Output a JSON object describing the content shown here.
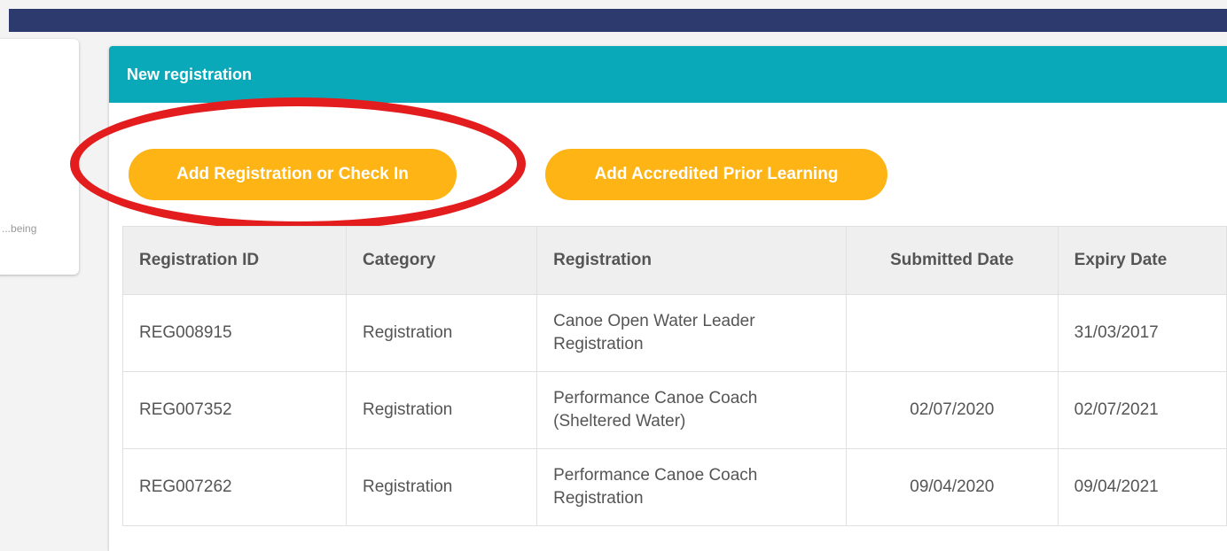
{
  "side": {
    "snippet": "being..."
  },
  "panel": {
    "title": "New registration",
    "buttons": {
      "add_registration": "Add Registration or Check In",
      "add_apl": "Add Accredited Prior Learning"
    }
  },
  "table": {
    "headers": [
      "Registration ID",
      "Category",
      "Registration",
      "Submitted Date",
      "Expiry Date"
    ],
    "rows": [
      {
        "id": "REG008915",
        "category": "Registration",
        "registration": "Canoe Open Water Leader Registration",
        "submitted": "",
        "expiry": "31/03/2017"
      },
      {
        "id": "REG007352",
        "category": "Registration",
        "registration": "Performance Canoe Coach (Sheltered Water)",
        "submitted": "02/07/2020",
        "expiry": "02/07/2021"
      },
      {
        "id": "REG007262",
        "category": "Registration",
        "registration": "Performance Canoe Coach Registration",
        "submitted": "09/04/2020",
        "expiry": "09/04/2021"
      }
    ]
  },
  "colors": {
    "header_bar": "#2c3a6e",
    "panel_header": "#0aa9b9",
    "button": "#fdb414",
    "highlight_circle": "#e31d1d"
  }
}
